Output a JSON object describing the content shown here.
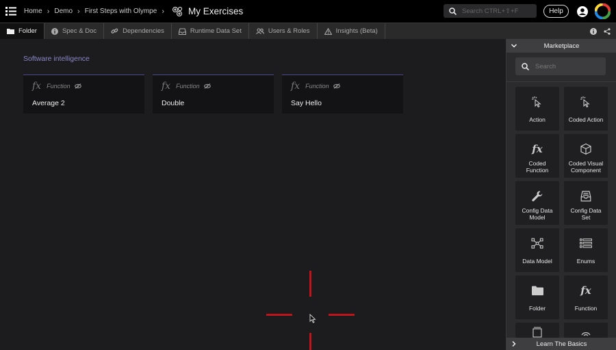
{
  "breadcrumb": [
    "Home",
    "Demo",
    "First Steps with Olympe"
  ],
  "page_title": "My Exercises",
  "search": {
    "placeholder": "Search CTRL+⇧+F"
  },
  "help_label": "Help",
  "tabs": [
    {
      "label": "Folder",
      "icon": "folder-icon"
    },
    {
      "label": "Spec & Doc",
      "icon": "info-icon"
    },
    {
      "label": "Dependencies",
      "icon": "link-icon"
    },
    {
      "label": "Runtime Data Set",
      "icon": "tray-icon"
    },
    {
      "label": "Users & Roles",
      "icon": "users-icon"
    },
    {
      "label": "Insights (Beta)",
      "icon": "warning-icon"
    }
  ],
  "section_title": "Software intelligence",
  "cards": [
    {
      "kind": "Function",
      "name": "Average 2"
    },
    {
      "kind": "Function",
      "name": "Double"
    },
    {
      "kind": "Function",
      "name": "Say Hello"
    }
  ],
  "marketplace": {
    "title": "Marketplace",
    "search_placeholder": "Search",
    "tiles": [
      {
        "label": "Action",
        "icon": "pointer-click-icon"
      },
      {
        "label": "Coded Action",
        "icon": "pointer-click-icon"
      },
      {
        "label": "Coded Function",
        "icon": "fx-icon"
      },
      {
        "label": "Coded Visual Component",
        "icon": "cube-icon"
      },
      {
        "label": "Config Data Model",
        "icon": "wrench-icon"
      },
      {
        "label": "Config Data Set",
        "icon": "tray-icon"
      },
      {
        "label": "Data Model",
        "icon": "graph-icon"
      },
      {
        "label": "Enums",
        "icon": "list-icon"
      },
      {
        "label": "Folder",
        "icon": "folder-icon"
      },
      {
        "label": "Function",
        "icon": "fx-icon"
      }
    ],
    "footer": "Learn The Basics"
  },
  "colors": {
    "accent": "#8a86c8",
    "card_border": "#4c4a8e",
    "crosshair": "#c0141b"
  }
}
